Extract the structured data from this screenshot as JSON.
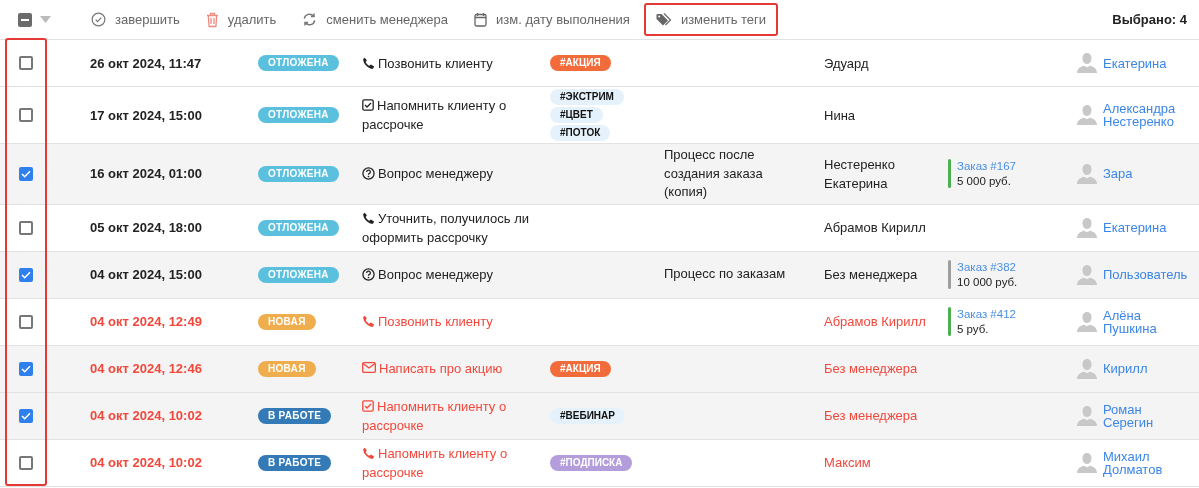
{
  "toolbar": {
    "select_all": {
      "indeterminate": true
    },
    "actions": [
      {
        "kind": "complete",
        "label": "завершить",
        "highlighted": false
      },
      {
        "kind": "delete",
        "label": "удалить",
        "highlighted": false
      },
      {
        "kind": "reassign",
        "label": "сменить менеджера",
        "highlighted": false
      },
      {
        "kind": "date",
        "label": "изм. дату выполнения",
        "highlighted": false
      },
      {
        "kind": "tags",
        "label": "изменить теги",
        "highlighted": true
      }
    ],
    "selected_count": "Выбрано: 4"
  },
  "checkbox_column": {
    "highlighted": true
  },
  "rows": [
    {
      "checked": false,
      "overdue": false,
      "date": "26 окт 2024, 11:47",
      "status": {
        "label": "ОТЛОЖЕНА",
        "color": "#5bc0de"
      },
      "task": {
        "kind": "call",
        "text": "Позвонить клиенту"
      },
      "tags": [
        {
          "label": "#АКЦИЯ",
          "color": "#f26b3a"
        }
      ],
      "manager": "Эдуард",
      "client": "Екатерина"
    },
    {
      "checked": false,
      "overdue": false,
      "date": "17 окт 2024, 15:00",
      "status": {
        "label": "ОТЛОЖЕНА",
        "color": "#5bc0de"
      },
      "task": {
        "kind": "reminder",
        "text": "Напомнить клиенту о рассрочке"
      },
      "tags": [
        {
          "label": "#ЭКСТРИМ",
          "color": "#e6f2fb"
        },
        {
          "label": "#ЦВЕТ",
          "color": "#e6f2fb"
        },
        {
          "label": "#ПОТОК",
          "color": "#e6f2fb"
        }
      ],
      "manager": "Нина",
      "client": "Александра Нестеренко"
    },
    {
      "checked": true,
      "overdue": false,
      "date": "16 окт 2024, 01:00",
      "status": {
        "label": "ОТЛОЖЕНА",
        "color": "#5bc0de"
      },
      "task": {
        "kind": "question",
        "text": "Вопрос менеджеру"
      },
      "process": "Процесс после создания заказа (копия)",
      "manager": "Нестеренко Екатерина",
      "order": {
        "link": "Заказ #167",
        "amount": "5 000 руб.",
        "color": "#4caf50"
      },
      "client": "Зара"
    },
    {
      "checked": false,
      "overdue": false,
      "date": "05 окт 2024, 18:00",
      "status": {
        "label": "ОТЛОЖЕНА",
        "color": "#5bc0de"
      },
      "task": {
        "kind": "call",
        "text": "Уточнить, получилось ли оформить рассрочку"
      },
      "manager": "Абрамов Кирилл",
      "client": "Екатерина"
    },
    {
      "checked": true,
      "overdue": false,
      "date": "04 окт 2024, 15:00",
      "status": {
        "label": "ОТЛОЖЕНА",
        "color": "#5bc0de"
      },
      "task": {
        "kind": "question",
        "text": "Вопрос менеджеру"
      },
      "process": "Процесс по заказам",
      "manager": "Без менеджера",
      "order": {
        "link": "Заказ #382",
        "amount": "10 000 руб.",
        "color": "#9e9e9e"
      },
      "client": "Пользователь"
    },
    {
      "checked": false,
      "overdue": true,
      "date": "04 окт 2024, 12:49",
      "status": {
        "label": "НОВАЯ",
        "color": "#f0ad4e"
      },
      "task": {
        "kind": "call",
        "text": "Позвонить клиенту"
      },
      "manager": "Абрамов Кирилл",
      "order": {
        "link": "Заказ #412",
        "amount": "5 руб.",
        "color": "#4caf50"
      },
      "client": "Алёна Пушкина"
    },
    {
      "checked": true,
      "overdue": true,
      "date": "04 окт 2024, 12:46",
      "status": {
        "label": "НОВАЯ",
        "color": "#f0ad4e"
      },
      "task": {
        "kind": "email",
        "text": "Написать про акцию"
      },
      "tags": [
        {
          "label": "#АКЦИЯ",
          "color": "#f26b3a"
        }
      ],
      "manager": "Без менеджера",
      "client": "Кирилл"
    },
    {
      "checked": true,
      "overdue": true,
      "date": "04 окт 2024, 10:02",
      "status": {
        "label": "В РАБОТЕ",
        "color": "#337ab7"
      },
      "task": {
        "kind": "reminder",
        "text": "Напомнить клиенту о рассрочке"
      },
      "tags": [
        {
          "label": "#ВЕБИНАР",
          "color": "#e6f2fb"
        }
      ],
      "manager": "Без менеджера",
      "client": "Роман Серегин"
    },
    {
      "checked": false,
      "overdue": true,
      "date": "04 окт 2024, 10:02",
      "status": {
        "label": "В РАБОТЕ",
        "color": "#337ab7"
      },
      "task": {
        "kind": "call",
        "text": "Напомнить клиенту о рассрочке"
      },
      "tags": [
        {
          "label": "#ПОДПИСКА",
          "color": "#b39ddb"
        }
      ],
      "manager": "Максим",
      "client": "Михаил Долматов"
    }
  ]
}
